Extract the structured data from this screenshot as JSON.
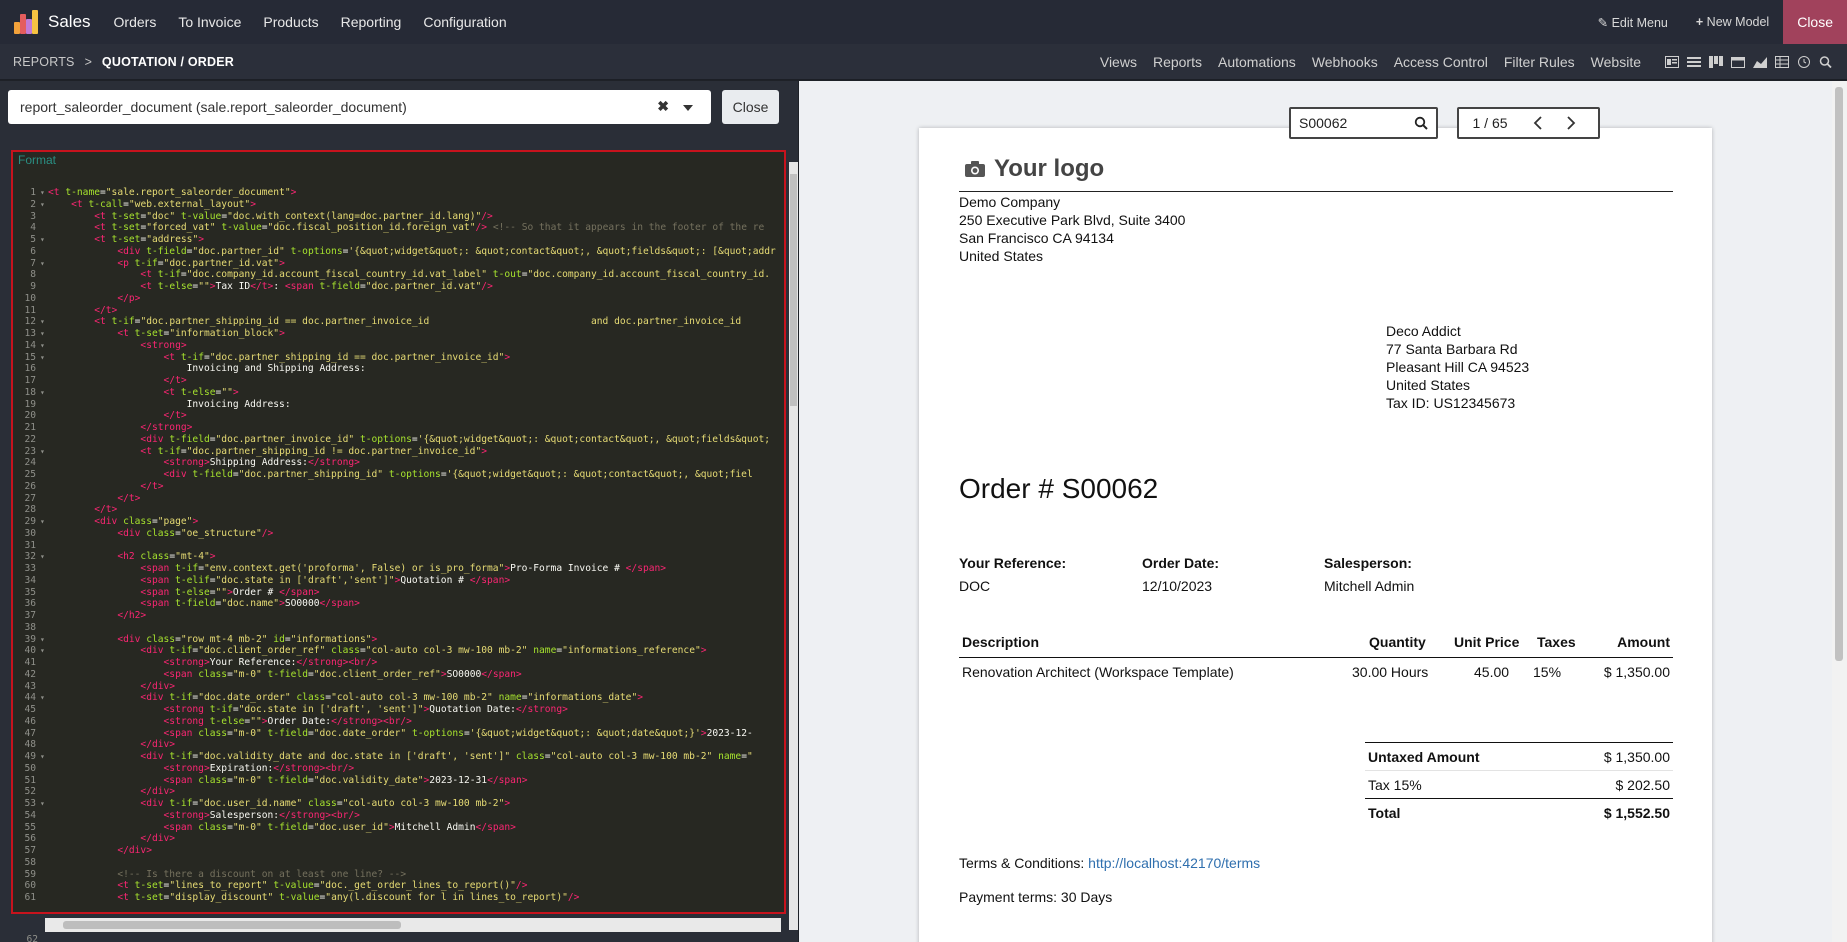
{
  "nav": {
    "brand": "Sales",
    "items": [
      "Orders",
      "To Invoice",
      "Products",
      "Reporting",
      "Configuration"
    ],
    "edit_menu": "Edit Menu",
    "new_model": "New Model",
    "close": "Close"
  },
  "subbar": {
    "crumb_parent": "REPORTS",
    "crumb_sep": ">",
    "crumb_current": "QUOTATION / ORDER",
    "links": [
      "Views",
      "Reports",
      "Automations",
      "Webhooks",
      "Access Control",
      "Filter Rules",
      "Website"
    ]
  },
  "editor": {
    "template_value": "report_saleorder_document (sale.report_saleorder_document)",
    "close_label": "Close",
    "format_label": "Format",
    "last_line": "62"
  },
  "code_lines": [
    {
      "n": "1",
      "f": true,
      "html": "<span class='tag'>&lt;t</span> <span class='attr'>t-name</span>=<span class='str'>\"sale.report_saleorder_document\"</span><span class='tag'>&gt;</span>"
    },
    {
      "n": "2",
      "f": true,
      "html": "    <span class='tag'>&lt;t</span> <span class='attr'>t-call</span>=<span class='str'>\"web.external_layout\"</span><span class='tag'>&gt;</span>"
    },
    {
      "n": "3",
      "f": false,
      "html": "        <span class='tag'>&lt;t</span> <span class='attr'>t-set</span>=<span class='str'>\"doc\"</span> <span class='attr'>t-value</span>=<span class='str'>\"doc.with_context(lang=doc.partner_id.lang)\"</span><span class='tag'>/&gt;</span>"
    },
    {
      "n": "4",
      "f": false,
      "html": "        <span class='tag'>&lt;t</span> <span class='attr'>t-set</span>=<span class='str'>\"forced_vat\"</span> <span class='attr'>t-value</span>=<span class='str'>\"doc.fiscal_position_id.foreign_vat\"</span><span class='tag'>/&gt;</span> <span class='cmt'>&lt;!-- So that it appears in the footer of the re</span>"
    },
    {
      "n": "5",
      "f": true,
      "html": "        <span class='tag'>&lt;t</span> <span class='attr'>t-set</span>=<span class='str'>\"address\"</span><span class='tag'>&gt;</span>"
    },
    {
      "n": "6",
      "f": false,
      "html": "            <span class='tag'>&lt;div</span> <span class='attr'>t-field</span>=<span class='str'>\"doc.partner_id\"</span> <span class='attr'>t-options</span>=<span class='str'>'{&amp;quot;widget&amp;quot;: &amp;quot;contact&amp;quot;, &amp;quot;fields&amp;quot;: [&amp;quot;addr</span>"
    },
    {
      "n": "7",
      "f": true,
      "html": "            <span class='tag'>&lt;p</span> <span class='attr'>t-if</span>=<span class='str'>\"doc.partner_id.vat\"</span><span class='tag'>&gt;</span>"
    },
    {
      "n": "8",
      "f": false,
      "html": "                <span class='tag'>&lt;t</span> <span class='attr'>t-if</span>=<span class='str'>\"doc.company_id.account_fiscal_country_id.vat_label\"</span> <span class='attr'>t-out</span>=<span class='str'>\"doc.company_id.account_fiscal_country_id.</span>"
    },
    {
      "n": "9",
      "f": false,
      "html": "                <span class='tag'>&lt;t</span> <span class='attr'>t-else</span>=<span class='str'>\"\"</span><span class='tag'>&gt;</span>Tax ID<span class='tag'>&lt;/t&gt;</span>: <span class='tag'>&lt;span</span> <span class='attr'>t-field</span>=<span class='str'>\"doc.partner_id.vat\"</span><span class='tag'>/&gt;</span>"
    },
    {
      "n": "10",
      "f": false,
      "html": "            <span class='tag'>&lt;/p&gt;</span>"
    },
    {
      "n": "11",
      "f": false,
      "html": "        <span class='tag'>&lt;/t&gt;</span>"
    },
    {
      "n": "12",
      "f": true,
      "html": "        <span class='tag'>&lt;t</span> <span class='attr'>t-if</span>=<span class='str'>\"doc.partner_shipping_id == doc.partner_invoice_id                            and doc.partner_invoice_id</span>"
    },
    {
      "n": "13",
      "f": true,
      "html": "            <span class='tag'>&lt;t</span> <span class='attr'>t-set</span>=<span class='str'>\"information_block\"</span><span class='tag'>&gt;</span>"
    },
    {
      "n": "14",
      "f": true,
      "html": "                <span class='tag'>&lt;strong&gt;</span>"
    },
    {
      "n": "15",
      "f": true,
      "html": "                    <span class='tag'>&lt;t</span> <span class='attr'>t-if</span>=<span class='str'>\"doc.partner_shipping_id == doc.partner_invoice_id\"</span><span class='tag'>&gt;</span>"
    },
    {
      "n": "16",
      "f": false,
      "html": "                        Invoicing and Shipping Address:"
    },
    {
      "n": "17",
      "f": false,
      "html": "                    <span class='tag'>&lt;/t&gt;</span>"
    },
    {
      "n": "18",
      "f": true,
      "html": "                    <span class='tag'>&lt;t</span> <span class='attr'>t-else</span>=<span class='str'>\"\"</span><span class='tag'>&gt;</span>"
    },
    {
      "n": "19",
      "f": false,
      "html": "                        Invoicing Address:"
    },
    {
      "n": "20",
      "f": false,
      "html": "                    <span class='tag'>&lt;/t&gt;</span>"
    },
    {
      "n": "21",
      "f": false,
      "html": "                <span class='tag'>&lt;/strong&gt;</span>"
    },
    {
      "n": "22",
      "f": false,
      "html": "                <span class='tag'>&lt;div</span> <span class='attr'>t-field</span>=<span class='str'>\"doc.partner_invoice_id\"</span> <span class='attr'>t-options</span>=<span class='str'>'{&amp;quot;widget&amp;quot;: &amp;quot;contact&amp;quot;, &amp;quot;fields&amp;quot;</span>"
    },
    {
      "n": "23",
      "f": true,
      "html": "                <span class='tag'>&lt;t</span> <span class='attr'>t-if</span>=<span class='str'>\"doc.partner_shipping_id != doc.partner_invoice_id\"</span><span class='tag'>&gt;</span>"
    },
    {
      "n": "24",
      "f": false,
      "html": "                    <span class='tag'>&lt;strong&gt;</span>Shipping Address:<span class='tag'>&lt;/strong&gt;</span>"
    },
    {
      "n": "25",
      "f": false,
      "html": "                    <span class='tag'>&lt;div</span> <span class='attr'>t-field</span>=<span class='str'>\"doc.partner_shipping_id\"</span> <span class='attr'>t-options</span>=<span class='str'>'{&amp;quot;widget&amp;quot;: &amp;quot;contact&amp;quot;, &amp;quot;fiel</span>"
    },
    {
      "n": "26",
      "f": false,
      "html": "                <span class='tag'>&lt;/t&gt;</span>"
    },
    {
      "n": "27",
      "f": false,
      "html": "            <span class='tag'>&lt;/t&gt;</span>"
    },
    {
      "n": "28",
      "f": false,
      "html": "        <span class='tag'>&lt;/t&gt;</span>"
    },
    {
      "n": "29",
      "f": true,
      "html": "        <span class='tag'>&lt;div</span> <span class='attr'>class</span>=<span class='str'>\"page\"</span><span class='tag'>&gt;</span>"
    },
    {
      "n": "30",
      "f": false,
      "html": "            <span class='tag'>&lt;div</span> <span class='attr'>class</span>=<span class='str'>\"oe_structure\"</span><span class='tag'>/&gt;</span>"
    },
    {
      "n": "31",
      "f": false,
      "html": ""
    },
    {
      "n": "32",
      "f": true,
      "html": "            <span class='tag'>&lt;h2</span> <span class='attr'>class</span>=<span class='str'>\"mt-4\"</span><span class='tag'>&gt;</span>"
    },
    {
      "n": "33",
      "f": false,
      "html": "                <span class='tag'>&lt;span</span> <span class='attr'>t-if</span>=<span class='str'>\"env.context.get('proforma', False) or is_pro_forma\"</span><span class='tag'>&gt;</span>Pro-Forma Invoice # <span class='tag'>&lt;/span&gt;</span>"
    },
    {
      "n": "34",
      "f": false,
      "html": "                <span class='tag'>&lt;span</span> <span class='attr'>t-elif</span>=<span class='str'>\"doc.state in ['draft','sent']\"</span><span class='tag'>&gt;</span>Quotation # <span class='tag'>&lt;/span&gt;</span>"
    },
    {
      "n": "35",
      "f": false,
      "html": "                <span class='tag'>&lt;span</span> <span class='attr'>t-else</span>=<span class='str'>\"\"</span><span class='tag'>&gt;</span>Order # <span class='tag'>&lt;/span&gt;</span>"
    },
    {
      "n": "36",
      "f": false,
      "html": "                <span class='tag'>&lt;span</span> <span class='attr'>t-field</span>=<span class='str'>\"doc.name\"</span><span class='tag'>&gt;</span>SO0000<span class='tag'>&lt;/span&gt;</span>"
    },
    {
      "n": "37",
      "f": false,
      "html": "            <span class='tag'>&lt;/h2&gt;</span>"
    },
    {
      "n": "38",
      "f": false,
      "html": ""
    },
    {
      "n": "39",
      "f": true,
      "html": "            <span class='tag'>&lt;div</span> <span class='attr'>class</span>=<span class='str'>\"row mt-4 mb-2\"</span> <span class='attr'>id</span>=<span class='str'>\"informations\"</span><span class='tag'>&gt;</span>"
    },
    {
      "n": "40",
      "f": true,
      "html": "                <span class='tag'>&lt;div</span> <span class='attr'>t-if</span>=<span class='str'>\"doc.client_order_ref\"</span> <span class='attr'>class</span>=<span class='str'>\"col-auto col-3 mw-100 mb-2\"</span> <span class='attr'>name</span>=<span class='str'>\"informations_reference\"</span><span class='tag'>&gt;</span>"
    },
    {
      "n": "41",
      "f": false,
      "html": "                    <span class='tag'>&lt;strong&gt;</span>Your Reference:<span class='tag'>&lt;/strong&gt;&lt;br/&gt;</span>"
    },
    {
      "n": "42",
      "f": false,
      "html": "                    <span class='tag'>&lt;span</span> <span class='attr'>class</span>=<span class='str'>\"m-0\"</span> <span class='attr'>t-field</span>=<span class='str'>\"doc.client_order_ref\"</span><span class='tag'>&gt;</span>SO0000<span class='tag'>&lt;/span&gt;</span>"
    },
    {
      "n": "43",
      "f": false,
      "html": "                <span class='tag'>&lt;/div&gt;</span>"
    },
    {
      "n": "44",
      "f": true,
      "html": "                <span class='tag'>&lt;div</span> <span class='attr'>t-if</span>=<span class='str'>\"doc.date_order\"</span> <span class='attr'>class</span>=<span class='str'>\"col-auto col-3 mw-100 mb-2\"</span> <span class='attr'>name</span>=<span class='str'>\"informations_date\"</span><span class='tag'>&gt;</span>"
    },
    {
      "n": "45",
      "f": false,
      "html": "                    <span class='tag'>&lt;strong</span> <span class='attr'>t-if</span>=<span class='str'>\"doc.state in ['draft', 'sent']\"</span><span class='tag'>&gt;</span>Quotation Date:<span class='tag'>&lt;/strong&gt;</span>"
    },
    {
      "n": "46",
      "f": false,
      "html": "                    <span class='tag'>&lt;strong</span> <span class='attr'>t-else</span>=<span class='str'>\"\"</span><span class='tag'>&gt;</span>Order Date:<span class='tag'>&lt;/strong&gt;&lt;br/&gt;</span>"
    },
    {
      "n": "47",
      "f": false,
      "html": "                    <span class='tag'>&lt;span</span> <span class='attr'>class</span>=<span class='str'>\"m-0\"</span> <span class='attr'>t-field</span>=<span class='str'>\"doc.date_order\"</span> <span class='attr'>t-options</span>=<span class='str'>'{&amp;quot;widget&amp;quot;: &amp;quot;date&amp;quot;}'</span><span class='tag'>&gt;</span>2023-12-</span>"
    },
    {
      "n": "48",
      "f": false,
      "html": "                <span class='tag'>&lt;/div&gt;</span>"
    },
    {
      "n": "49",
      "f": true,
      "html": "                <span class='tag'>&lt;div</span> <span class='attr'>t-if</span>=<span class='str'>\"doc.validity_date and doc.state in ['draft', 'sent']\"</span> <span class='attr'>class</span>=<span class='str'>\"col-auto col-3 mw-100 mb-2\"</span> <span class='attr'>name</span>=<span class='str'>\"</span>"
    },
    {
      "n": "50",
      "f": false,
      "html": "                    <span class='tag'>&lt;strong&gt;</span>Expiration:<span class='tag'>&lt;/strong&gt;&lt;br/&gt;</span>"
    },
    {
      "n": "51",
      "f": false,
      "html": "                    <span class='tag'>&lt;span</span> <span class='attr'>class</span>=<span class='str'>\"m-0\"</span> <span class='attr'>t-field</span>=<span class='str'>\"doc.validity_date\"</span><span class='tag'>&gt;</span>2023-12-31<span class='tag'>&lt;/span&gt;</span>"
    },
    {
      "n": "52",
      "f": false,
      "html": "                <span class='tag'>&lt;/div&gt;</span>"
    },
    {
      "n": "53",
      "f": true,
      "html": "                <span class='tag'>&lt;div</span> <span class='attr'>t-if</span>=<span class='str'>\"doc.user_id.name\"</span> <span class='attr'>class</span>=<span class='str'>\"col-auto col-3 mw-100 mb-2\"</span><span class='tag'>&gt;</span>"
    },
    {
      "n": "54",
      "f": false,
      "html": "                    <span class='tag'>&lt;strong&gt;</span>Salesperson:<span class='tag'>&lt;/strong&gt;&lt;br/&gt;</span>"
    },
    {
      "n": "55",
      "f": false,
      "html": "                    <span class='tag'>&lt;span</span> <span class='attr'>class</span>=<span class='str'>\"m-0\"</span> <span class='attr'>t-field</span>=<span class='str'>\"doc.user_id\"</span><span class='tag'>&gt;</span>Mitchell Admin<span class='tag'>&lt;/span&gt;</span>"
    },
    {
      "n": "56",
      "f": false,
      "html": "                <span class='tag'>&lt;/div&gt;</span>"
    },
    {
      "n": "57",
      "f": false,
      "html": "            <span class='tag'>&lt;/div&gt;</span>"
    },
    {
      "n": "58",
      "f": false,
      "html": ""
    },
    {
      "n": "59",
      "f": false,
      "html": "            <span class='cmt'>&lt;!-- Is there a discount on at least one line? --&gt;</span>"
    },
    {
      "n": "60",
      "f": false,
      "html": "            <span class='tag'>&lt;t</span> <span class='attr'>t-set</span>=<span class='str'>\"lines_to_report\"</span> <span class='attr'>t-value</span>=<span class='str'>\"doc._get_order_lines_to_report()\"</span><span class='tag'>/&gt;</span>"
    },
    {
      "n": "61",
      "f": false,
      "html": "            <span class='tag'>&lt;t</span> <span class='attr'>t-set</span>=<span class='str'>\"display_discount\"</span> <span class='attr'>t-value</span>=<span class='str'>\"any(l.discount for l in lines_to_report)\"</span><span class='tag'>/&gt;</span>"
    }
  ],
  "preview": {
    "search_value": "S00062",
    "pager_value": "1 / 65",
    "logo_text": "Your logo",
    "company": [
      "Demo Company",
      "250 Executive Park Blvd, Suite 3400",
      "San Francisco CA 94134",
      "United States"
    ],
    "customer": [
      "Deco Addict",
      "77 Santa Barbara Rd",
      "Pleasant Hill CA 94523",
      "United States",
      "Tax ID: US12345673"
    ],
    "order_title": "Order # S00062",
    "info": {
      "ref_label": "Your Reference:",
      "ref_value": "DOC",
      "date_label": "Order Date:",
      "date_value": "12/10/2023",
      "sales_label": "Salesperson:",
      "sales_value": "Mitchell Admin"
    },
    "table": {
      "h_desc": "Description",
      "h_qty": "Quantity",
      "h_price": "Unit Price",
      "h_taxes": "Taxes",
      "h_amount": "Amount",
      "row": {
        "desc": "Renovation Architect (Workspace Template)",
        "qty": "30.00 Hours",
        "price": "45.00",
        "taxes": "15%",
        "amount": "$ 1,350.00"
      }
    },
    "totals": {
      "untaxed_label": "Untaxed Amount",
      "untaxed_value": "$ 1,350.00",
      "tax_label": "Tax 15%",
      "tax_value": "$ 202.50",
      "total_label": "Total",
      "total_value": "$ 1,552.50"
    },
    "terms_label": "Terms & Conditions:",
    "terms_link": "http://localhost:42170/terms",
    "payment_terms": "Payment terms: 30 Days"
  }
}
